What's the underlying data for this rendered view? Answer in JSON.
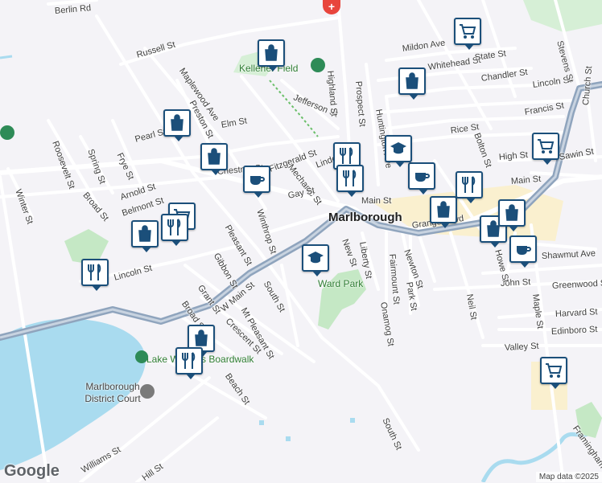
{
  "town": "Marlborough",
  "parks": [
    "Ward Park",
    "Kelleher Field",
    "Lake Williams Boardwalk"
  ],
  "places": [
    "Marlborough District Court"
  ],
  "streets": [
    "Berlin Rd",
    "Russell St",
    "Maplewood Ave",
    "Preston St",
    "Jefferson St",
    "Highland St",
    "Prospect St",
    "Elm St",
    "Pearl St",
    "Roosevelt St",
    "Spring St",
    "Frye St",
    "Chestnut St",
    "Fitzgerald St",
    "Mechanic St",
    "Linden St",
    "Gay St",
    "Main St",
    "Arnold St",
    "Broad St",
    "Belmont St",
    "Winter St",
    "Winthrop St",
    "Pleasant St",
    "Lincoln St",
    "Gibbon St",
    "South St",
    "W Main St",
    "Grant St",
    "Broad St",
    "Mt Pleasant St",
    "Crescent St",
    "Beach St",
    "Williams St",
    "Hill St",
    "New St",
    "Liberty St",
    "Fairmount St",
    "Newton St",
    "Park St",
    "Onamog St",
    "Granger Blvd",
    "Mildon Ave",
    "Whitehead St",
    "State St",
    "Chandler St",
    "Lincoln St",
    "Francis St",
    "Rice St",
    "High St",
    "Sawin St",
    "Main St",
    "Shawmut Ave",
    "John St",
    "Greenwood St",
    "Harvard St",
    "Edinboro St",
    "Valley St",
    "Howe St",
    "Neil St",
    "Maple St",
    "Stevens St",
    "Church St",
    "Framingham",
    "South St",
    "Huntington Ave",
    "Bolton St"
  ],
  "markers": [
    {
      "type": "shopping",
      "label": "shopping-bag"
    },
    {
      "type": "shopping",
      "label": "shopping-bag"
    },
    {
      "type": "shopping",
      "label": "shopping-bag"
    },
    {
      "type": "shopping",
      "label": "shopping-bag"
    },
    {
      "type": "shopping",
      "label": "shopping-bag"
    },
    {
      "type": "shopping",
      "label": "shopping-bag"
    },
    {
      "type": "shopping",
      "label": "shopping-bag"
    },
    {
      "type": "cart",
      "label": "shopping-cart"
    },
    {
      "type": "cart",
      "label": "shopping-cart"
    },
    {
      "type": "cart",
      "label": "shopping-cart"
    },
    {
      "type": "cart",
      "label": "shopping-cart"
    },
    {
      "type": "cafe",
      "label": "coffee-cup"
    },
    {
      "type": "cafe",
      "label": "coffee-cup"
    },
    {
      "type": "cafe",
      "label": "coffee-cup"
    },
    {
      "type": "restaurant",
      "label": "fork-knife"
    },
    {
      "type": "restaurant",
      "label": "fork-knife"
    },
    {
      "type": "restaurant",
      "label": "fork-knife"
    },
    {
      "type": "restaurant",
      "label": "fork-knife"
    },
    {
      "type": "restaurant",
      "label": "fork-knife"
    },
    {
      "type": "restaurant",
      "label": "fork-knife"
    },
    {
      "type": "school",
      "label": "graduation-cap"
    },
    {
      "type": "school",
      "label": "graduation-cap"
    }
  ],
  "footer": {
    "logo": "Google",
    "attribution": "Map data ©2025"
  },
  "colors": {
    "marker_border": "#1b4f7a",
    "highway": "#8fa4bd",
    "water": "#a9dbef",
    "park": "#c5e8c5",
    "shopping_area": "#faf0cf"
  }
}
